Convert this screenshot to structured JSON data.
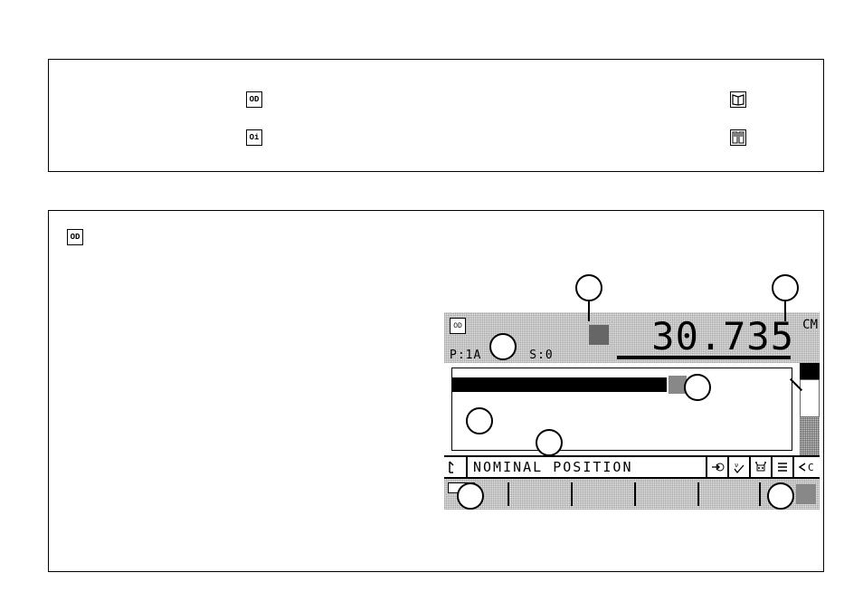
{
  "top_panel": {
    "icons": {
      "left1": "OD",
      "left2": "Oi",
      "right1": "book",
      "right2": "page"
    }
  },
  "bottom_panel": {
    "corner_icon": "OD"
  },
  "lcd": {
    "corner_icon": "OD",
    "value": "30.735",
    "unit": "CM",
    "status_p": "P:1A",
    "status_s": "S:0",
    "label": "NOMINAL POSITION",
    "right_icons": [
      "arrow-in",
      "nu-check",
      "robot",
      "lines",
      "back-c"
    ]
  }
}
